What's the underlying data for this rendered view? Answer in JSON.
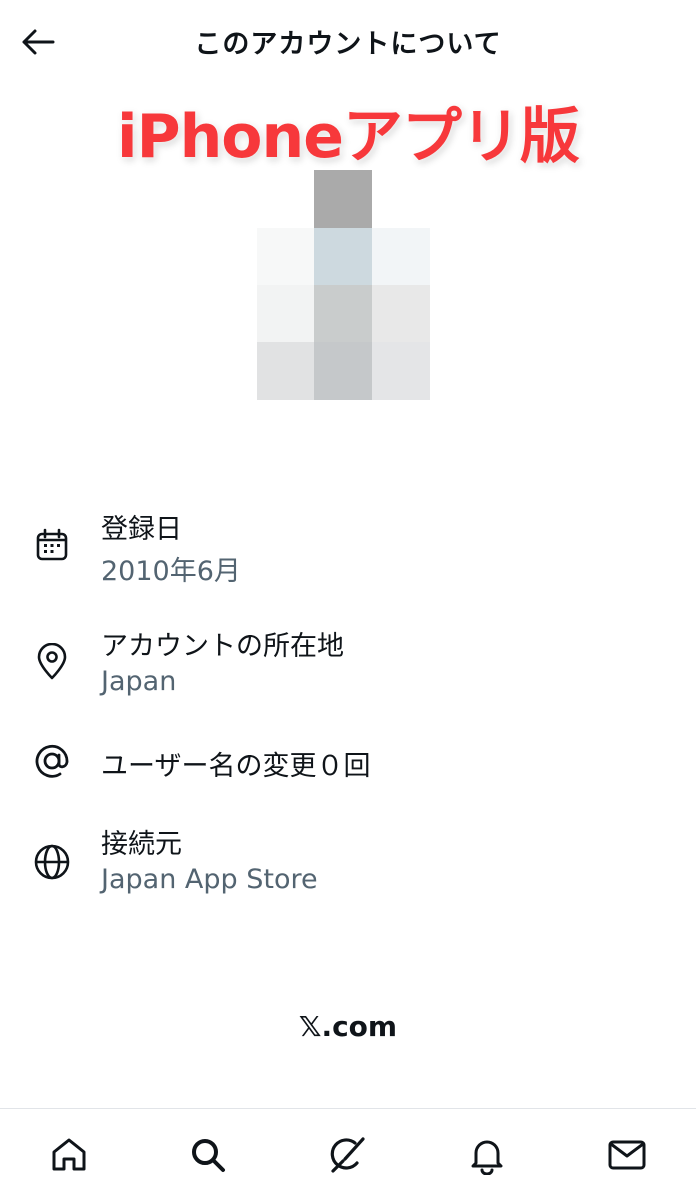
{
  "header": {
    "title": "このアカウントについて"
  },
  "overlay_label": "iPhoneアプリ版",
  "avatar": {
    "pixels": [
      "#ffffff",
      "#aaaaaa",
      "#ffffff",
      "#f7f8f8",
      "#cdd9df",
      "#f2f5f7",
      "#f2f3f3",
      "#c9cccc",
      "#e8e8e8",
      "#e1e2e3",
      "#c5c8ca",
      "#e4e5e7"
    ]
  },
  "info": [
    {
      "icon": "calendar-icon",
      "label": "登録日",
      "value": "2010年6月"
    },
    {
      "icon": "location-pin-icon",
      "label": "アカウントの所在地",
      "value": "Japan"
    },
    {
      "icon": "at-sign-icon",
      "label": "ユーザー名の変更０回",
      "value": ""
    },
    {
      "icon": "globe-icon",
      "label": "接続元",
      "value": "Japan App Store"
    }
  ],
  "footer": {
    "brand": "𝕏.com"
  },
  "nav": [
    "home-icon",
    "search-icon",
    "grok-icon",
    "notifications-icon",
    "messages-icon"
  ],
  "colors": {
    "text": "#0f1419",
    "secondary": "#536471",
    "overlay": "#f7383b"
  }
}
